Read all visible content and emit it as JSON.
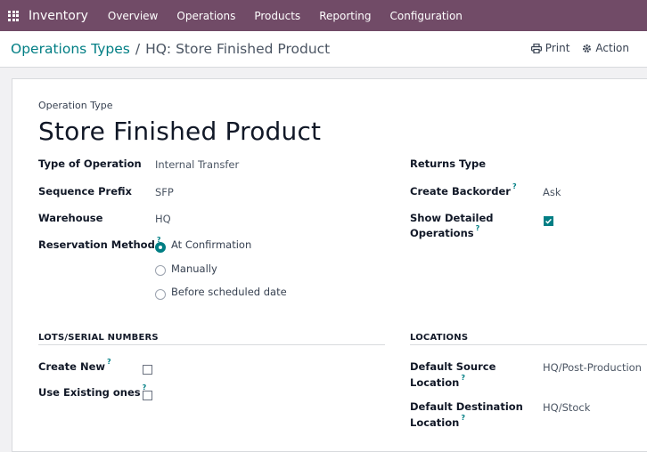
{
  "app": {
    "name": "Inventory"
  },
  "menu": [
    "Overview",
    "Operations",
    "Products",
    "Reporting",
    "Configuration"
  ],
  "breadcrumb": {
    "parent": "Operations Types",
    "separator": "/",
    "current": "HQ: Store Finished Product"
  },
  "actions": {
    "print": "Print",
    "action": "Action"
  },
  "form": {
    "type_label": "Operation Type",
    "title": "Store Finished Product",
    "fields": {
      "type_of_operation": {
        "label": "Type of Operation",
        "value": "Internal Transfer"
      },
      "sequence_prefix": {
        "label": "Sequence Prefix",
        "value": "SFP"
      },
      "warehouse": {
        "label": "Warehouse",
        "value": "HQ"
      },
      "reservation_method": {
        "label": "Reservation Method",
        "help": "?",
        "options": [
          "At Confirmation",
          "Manually",
          "Before scheduled date"
        ],
        "selected": "At Confirmation"
      },
      "returns_type": {
        "label": "Returns Type",
        "value": ""
      },
      "create_backorder": {
        "label": "Create Backorder",
        "help": "?",
        "value": "Ask"
      },
      "show_detailed_operations": {
        "label_line1": "Show Detailed",
        "label_line2": "Operations",
        "help": "?",
        "checked": true
      }
    },
    "lots": {
      "heading": "LOTS/SERIAL NUMBERS",
      "create_new": {
        "label": "Create New",
        "help": "?",
        "checked": false
      },
      "use_existing": {
        "label": "Use Existing ones",
        "help": "?",
        "checked": false
      }
    },
    "locations": {
      "heading": "LOCATIONS",
      "default_source": {
        "label_line1": "Default Source",
        "label_line2": "Location",
        "help": "?",
        "value": "HQ/Post-Production"
      },
      "default_destination": {
        "label_line1": "Default Destination",
        "label_line2": "Location",
        "help": "?",
        "value": "HQ/Stock"
      }
    }
  },
  "colors": {
    "topbar": "#714b67",
    "accent": "#017e84"
  }
}
